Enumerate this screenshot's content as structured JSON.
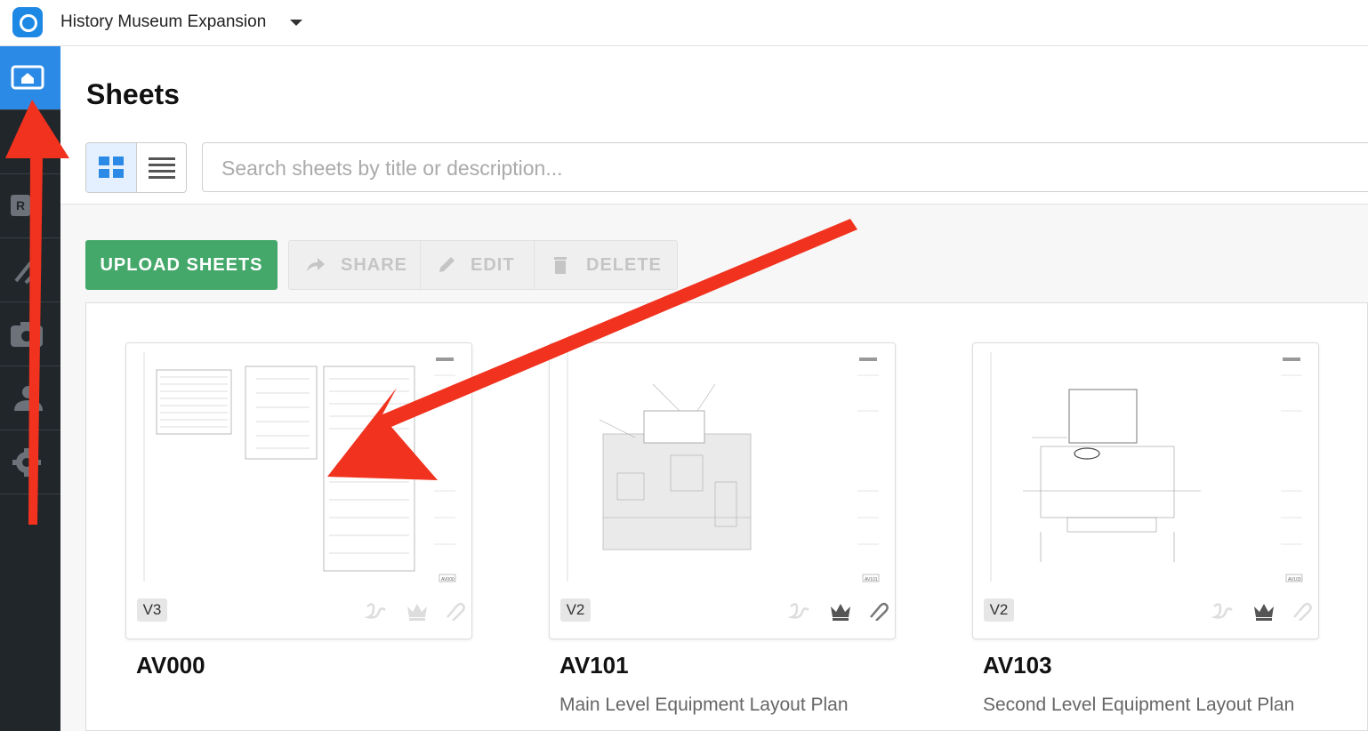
{
  "header": {
    "project_name": "History Museum Expansion"
  },
  "sidebar": {
    "items": [
      {
        "icon": "home-icon",
        "active": true
      },
      {
        "icon": "pin-icon"
      },
      {
        "icon": "rfi-icon",
        "label": "R"
      },
      {
        "icon": "paperclip-icon"
      },
      {
        "icon": "camera-icon"
      },
      {
        "icon": "person-icon"
      },
      {
        "icon": "gear-icon"
      }
    ]
  },
  "main": {
    "title": "Sheets",
    "search": {
      "placeholder": "Search sheets by title or description..."
    },
    "toolbar": {
      "upload_label": "UPLOAD SHEETS",
      "share_label": "SHARE",
      "edit_label": "EDIT",
      "delete_label": "DELETE"
    },
    "sheets": [
      {
        "number": "AV000",
        "description": "",
        "version": "V3",
        "tag": "AV000"
      },
      {
        "number": "AV101",
        "description": "Main Level Equipment Layout Plan",
        "version": "V2",
        "tag": "AV101"
      },
      {
        "number": "AV103",
        "description": "Second Level Equipment Layout Plan",
        "version": "V2",
        "tag": "AV103"
      }
    ]
  },
  "colors": {
    "sidebar_bg": "#21262b",
    "accent_blue": "#2b8ae6",
    "upload_green": "#45a86b",
    "annotation_red": "#f0321e"
  }
}
